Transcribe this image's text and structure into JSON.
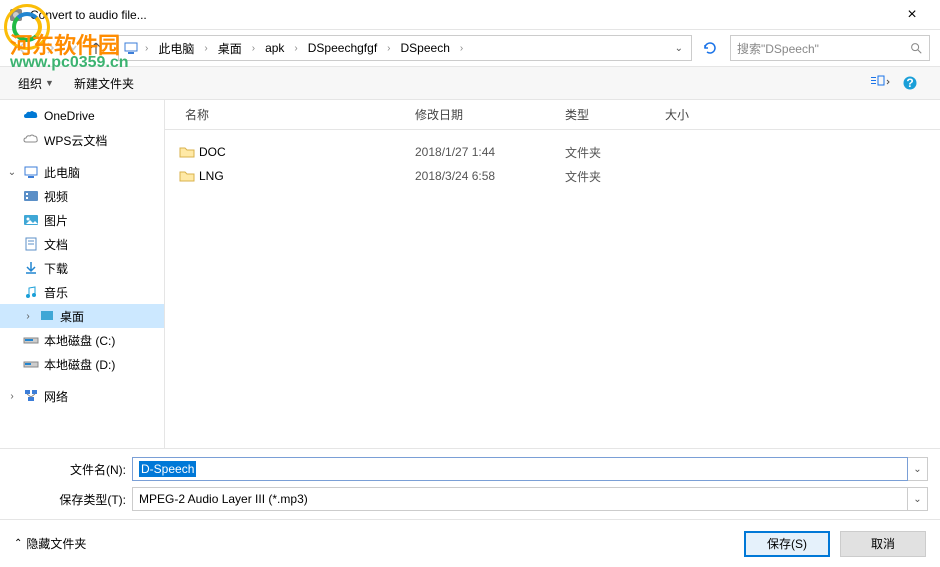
{
  "window": {
    "title": "Convert to audio file..."
  },
  "breadcrumb": {
    "pc": "此电脑",
    "items": [
      "桌面",
      "apk",
      "DSpeechgfgf",
      "DSpeech"
    ]
  },
  "search": {
    "placeholder": "搜索\"DSpeech\""
  },
  "toolbar": {
    "organize": "组织",
    "newfolder": "新建文件夹"
  },
  "sidebar": {
    "onedrive": "OneDrive",
    "wps": "WPS云文档",
    "thispc": "此电脑",
    "video": "视频",
    "pictures": "图片",
    "documents": "文档",
    "downloads": "下载",
    "music": "音乐",
    "desktop": "桌面",
    "diskc": "本地磁盘 (C:)",
    "diskd": "本地磁盘 (D:)",
    "network": "网络"
  },
  "columns": {
    "name": "名称",
    "date": "修改日期",
    "type": "类型",
    "size": "大小"
  },
  "files": [
    {
      "name": "DOC",
      "date": "2018/1/27 1:44",
      "type": "文件夹"
    },
    {
      "name": "LNG",
      "date": "2018/3/24 6:58",
      "type": "文件夹"
    }
  ],
  "form": {
    "filename_label": "文件名(N):",
    "filename_value": "D-Speech",
    "filetype_label": "保存类型(T):",
    "filetype_value": "MPEG-2 Audio Layer III (*.mp3)"
  },
  "footer": {
    "hide": "隐藏文件夹",
    "save": "保存(S)",
    "cancel": "取消"
  },
  "watermark": {
    "line1": "河东软件园",
    "line2": "www.pc0359.cn"
  }
}
